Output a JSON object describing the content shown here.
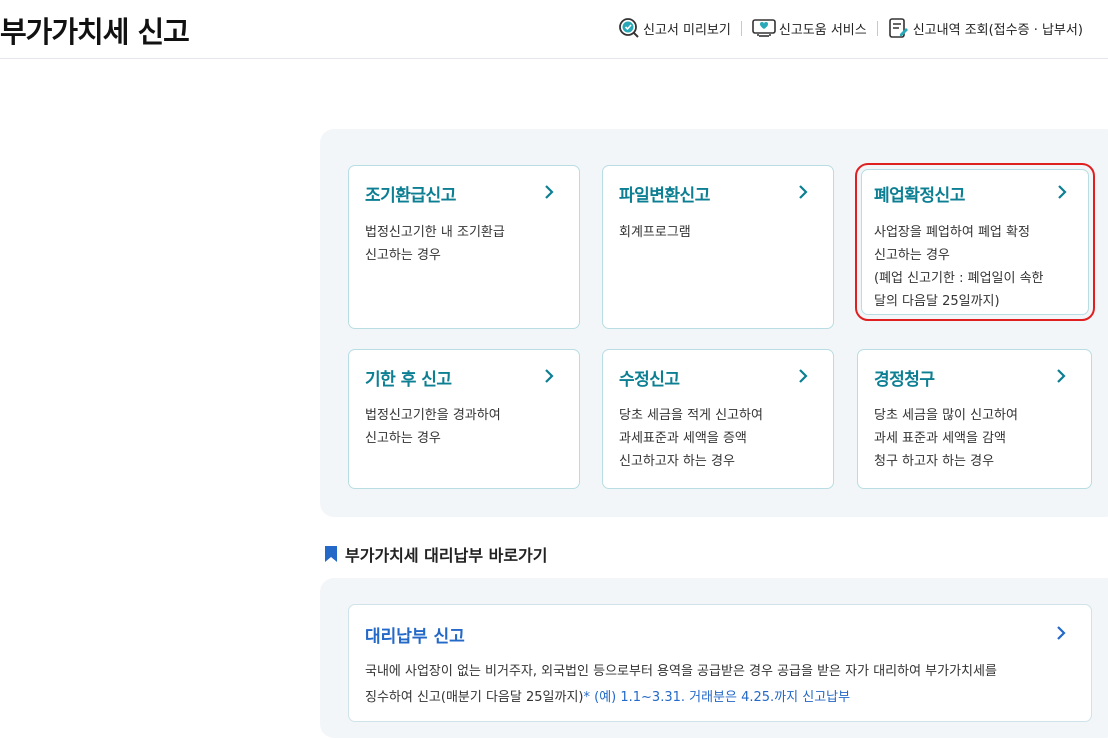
{
  "header": {
    "title": "부가가치세 신고",
    "links": [
      {
        "label": "신고서 미리보기",
        "icon": "search-check-icon"
      },
      {
        "label": "신고도움 서비스",
        "icon": "monitor-help-icon"
      },
      {
        "label": "신고내역 조회(접수증 · 납부서)",
        "icon": "document-edit-icon"
      }
    ]
  },
  "cards": [
    {
      "title": "조기환급신고",
      "lines": [
        "법정신고기한 내 조기환급",
        "신고하는 경우"
      ]
    },
    {
      "title": "파일변환신고",
      "lines": [
        "회계프로그램"
      ]
    },
    {
      "title": "폐업확정신고",
      "lines": [
        "사업장을 폐업하여 폐업 확정",
        "신고하는 경우",
        "(폐업 신고기한 : 폐업일이 속한",
        "달의 다음달 25일까지)"
      ],
      "selected": true
    },
    {
      "title": "기한 후 신고",
      "lines": [
        "법정신고기한을 경과하여",
        "신고하는 경우"
      ]
    },
    {
      "title": "수정신고",
      "lines": [
        "당초 세금을 적게 신고하여",
        "과세표준과 세액을 증액",
        "신고하고자 하는 경우"
      ]
    },
    {
      "title": "경정청구",
      "lines": [
        "당초 세금을 많이 신고하여",
        "과세 표준과 세액을 감액",
        "청구 하고자 하는 경우"
      ]
    }
  ],
  "proxy_section": {
    "heading": "부가가치세 대리납부 바로가기",
    "card": {
      "title": "대리납부 신고",
      "line1": "국내에 사업장이 없는 비거주자, 외국법인 등으로부터 용역을 공급받은 경우 공급을 받은 자가 대리하여 부가가치세를",
      "line2": "징수하여 신고(매분기 다음달 25일까지)",
      "note": "* (예) 1.1~3.31. 거래분은 4.25.까지 신고납부"
    }
  },
  "colors": {
    "card_title": "#0d7f93",
    "proxy_title": "#2469c8",
    "selection_outline": "#e02020",
    "panel_bg": "#f3f6f9"
  }
}
